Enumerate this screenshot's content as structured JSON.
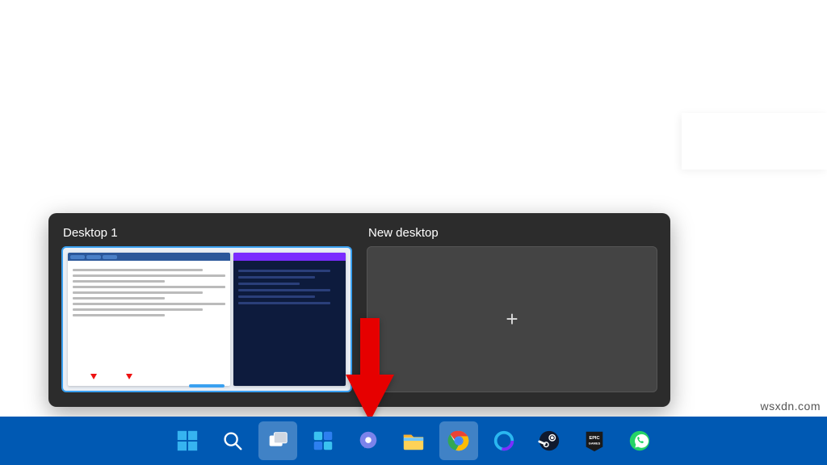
{
  "watermark": "wsxdn.com",
  "flyout": {
    "desktops": [
      {
        "label": "Desktop 1"
      },
      {
        "label": "New desktop"
      }
    ]
  },
  "taskbar": {
    "icons": [
      {
        "name": "start-icon"
      },
      {
        "name": "search-icon"
      },
      {
        "name": "task-view-icon",
        "active": true
      },
      {
        "name": "widgets-icon"
      },
      {
        "name": "chat-icon"
      },
      {
        "name": "file-explorer-icon"
      },
      {
        "name": "chrome-icon"
      },
      {
        "name": "cortana-icon"
      },
      {
        "name": "steam-icon"
      },
      {
        "name": "epic-games-icon"
      },
      {
        "name": "whatsapp-icon"
      }
    ]
  },
  "arrow_color": "#e60000"
}
